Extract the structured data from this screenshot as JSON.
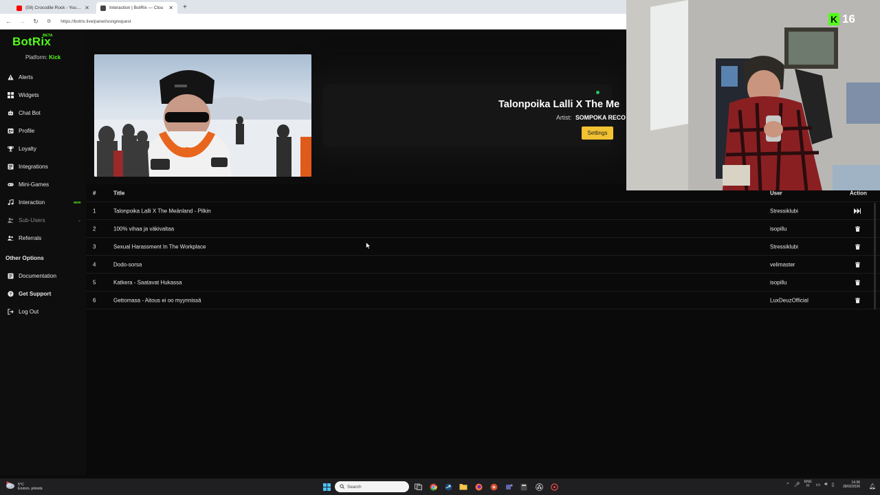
{
  "browser": {
    "tabs": [
      {
        "title": "(59) Crocodile Rock - YouTube",
        "favicon_color": "#ff0000"
      },
      {
        "title": "Interaction | BotRix — Clou",
        "favicon_color": "#444444"
      }
    ],
    "new_tab": "+",
    "url": "https://botrix.live/panel/songrequest"
  },
  "sidebar": {
    "logo": "BotRix",
    "beta": "BETA",
    "platform_label": "Platform:",
    "platform_value": "Kick",
    "items": [
      {
        "label": "Alerts",
        "icon": "warning-icon"
      },
      {
        "label": "Widgets",
        "icon": "widgets-icon"
      },
      {
        "label": "Chat Bot",
        "icon": "chatbot-icon"
      },
      {
        "label": "Profile",
        "icon": "profile-icon"
      },
      {
        "label": "Loyalty",
        "icon": "trophy-icon"
      },
      {
        "label": "Integrations",
        "icon": "integrations-icon"
      },
      {
        "label": "Mini-Games",
        "icon": "gamepad-icon"
      },
      {
        "label": "Interaction",
        "icon": "music-icon",
        "badge": "NEW"
      },
      {
        "label": "Sub-Users",
        "icon": "users-icon"
      },
      {
        "label": "Referrals",
        "icon": "referrals-icon"
      }
    ],
    "other_options_title": "Other Options",
    "other_items": [
      {
        "label": "Documentation",
        "icon": "document-icon"
      },
      {
        "label": "Get Support",
        "icon": "help-icon"
      },
      {
        "label": "Log Out",
        "icon": "logout-icon"
      }
    ]
  },
  "now_playing": {
    "title": "Talonpoika Lalli X The Me",
    "artist_label": "Artist:",
    "artist_value": "SOMPOKA RECO",
    "settings_label": "Settings"
  },
  "queue": {
    "headers": {
      "num": "#",
      "title": "Title",
      "user": "User",
      "action": "Action"
    },
    "rows": [
      {
        "num": "1",
        "title": "Talonpoika Lalli X The Meänland - Pilkin",
        "user": "Stressiklubi",
        "action": "skip-icon"
      },
      {
        "num": "2",
        "title": "100% vihaa ja väkivaltaa",
        "user": "isopillu",
        "action": "trash-icon"
      },
      {
        "num": "3",
        "title": "Sexual Harassment In The Workplace",
        "user": "Stressiklubi",
        "action": "trash-icon"
      },
      {
        "num": "4",
        "title": "Dodo-sorsa",
        "user": "velimaster",
        "action": "trash-icon"
      },
      {
        "num": "5",
        "title": "Katkera - Saatavat Hukassa",
        "user": "isopillu",
        "action": "trash-icon"
      },
      {
        "num": "6",
        "title": "Gettomasa - Aitous ei oo myynnissä",
        "user": "LuxDeuzOfficial",
        "action": "trash-icon"
      }
    ]
  },
  "overlay": {
    "kick_count": "16"
  },
  "taskbar": {
    "weather_temp": "5°C",
    "weather_desc": "Enimm. pilvistä",
    "search_placeholder": "Search",
    "lang_top": "ENG",
    "lang_bottom": "FI",
    "time": "14.06",
    "date": "28/02/2026"
  },
  "colors": {
    "kick_green": "#53fc18",
    "settings_yellow": "#f2c233",
    "status_green": "#22c55e",
    "background": "#0a0a0a"
  }
}
